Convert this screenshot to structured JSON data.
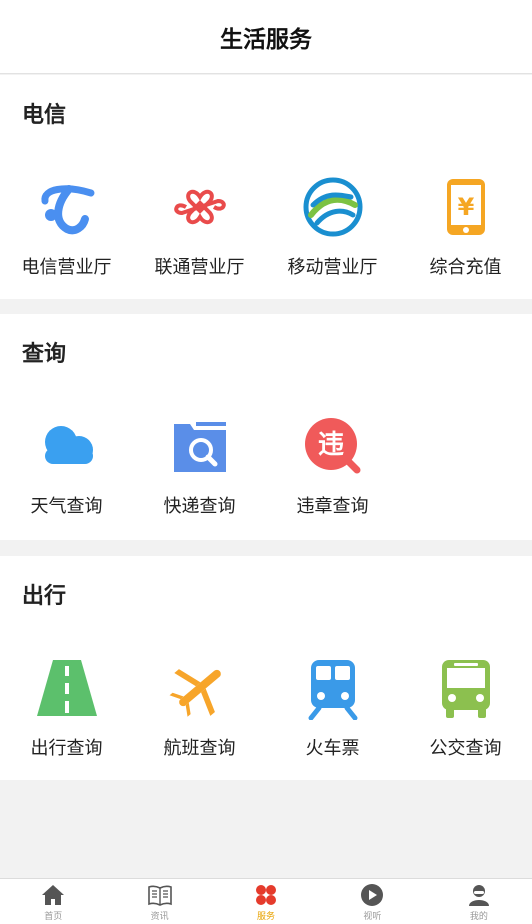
{
  "header": {
    "title": "生活服务"
  },
  "sections": {
    "telecom": {
      "title": "电信",
      "items": [
        {
          "label": "电信营业厅",
          "icon": "china-telecom-logo-icon"
        },
        {
          "label": "联通营业厅",
          "icon": "china-unicom-logo-icon"
        },
        {
          "label": "移动营业厅",
          "icon": "china-mobile-logo-icon"
        },
        {
          "label": "综合充值",
          "icon": "phone-recharge-icon"
        }
      ]
    },
    "query": {
      "title": "查询",
      "items": [
        {
          "label": "天气查询",
          "icon": "cloud-icon"
        },
        {
          "label": "快递查询",
          "icon": "package-search-icon"
        },
        {
          "label": "违章查询",
          "icon": "violation-search-icon",
          "glyph": "违"
        }
      ]
    },
    "travel": {
      "title": "出行",
      "items": [
        {
          "label": "出行查询",
          "icon": "road-icon"
        },
        {
          "label": "航班查询",
          "icon": "airplane-icon"
        },
        {
          "label": "火车票",
          "icon": "train-icon"
        },
        {
          "label": "公交查询",
          "icon": "bus-icon"
        }
      ]
    }
  },
  "tabbar": {
    "active": "服务",
    "tabs": [
      {
        "label": "首页",
        "icon": "home-icon"
      },
      {
        "label": "资讯",
        "icon": "news-icon"
      },
      {
        "label": "服务",
        "icon": "services-icon"
      },
      {
        "label": "视听",
        "icon": "play-icon"
      },
      {
        "label": "我的",
        "icon": "user-icon"
      }
    ]
  },
  "colors": {
    "telecom_blue": "#4a8ff0",
    "unicom_red": "#e94b4b",
    "mobile_blue": "#1a8fd0",
    "mobile_green": "#7cc243",
    "recharge_orange": "#f5a623",
    "weather_blue": "#3aa0f0",
    "parcel_blue": "#5a8ee8",
    "violation_red": "#f05a5a",
    "road_green": "#5cc06c",
    "plane_orange": "#f7a52a",
    "train_blue": "#3a9ae8",
    "bus_green": "#8cc04f",
    "tab_active": "#e8a200",
    "tab_active_icon": "#e53b2c",
    "tab_inactive": "#999999"
  }
}
